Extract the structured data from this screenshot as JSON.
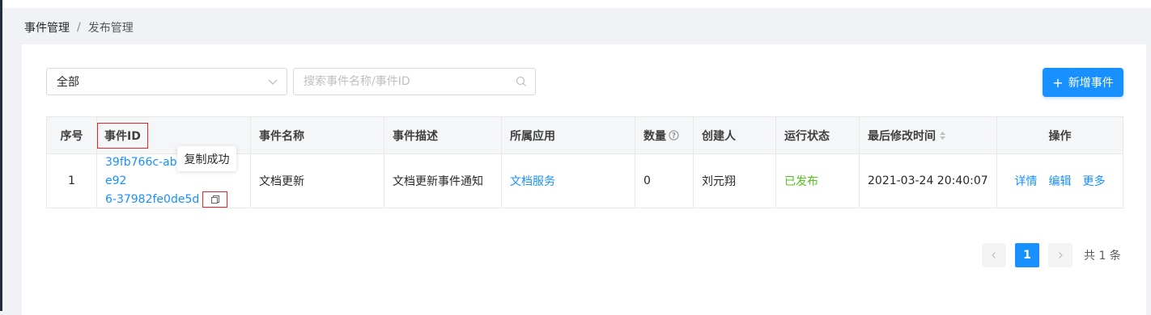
{
  "breadcrumb": {
    "parent": "事件管理",
    "separator": "/",
    "current": "发布管理"
  },
  "filters": {
    "select_value": "全部",
    "search_placeholder": "搜索事件名称/事件ID",
    "add_button": "新增事件"
  },
  "table": {
    "headers": {
      "index": "序号",
      "event_id": "事件ID",
      "event_name": "事件名称",
      "event_desc": "事件描述",
      "app": "所属应用",
      "count": "数量",
      "creator": "创建人",
      "status": "运行状态",
      "modified": "最后修改时间",
      "ops": "操作"
    },
    "rows": [
      {
        "index": "1",
        "event_id_line1": "39fb766c-ab2d-4c09-e92",
        "event_id_line2": "6-37982fe0de5d",
        "event_name": "文档更新",
        "event_desc": "文档更新事件通知",
        "app": "文档服务",
        "count": "0",
        "creator": "刘元翔",
        "status": "已发布",
        "modified": "2021-03-24 20:40:07",
        "op_detail": "详情",
        "op_edit": "编辑",
        "op_more": "更多"
      }
    ]
  },
  "tooltip": "复制成功",
  "pagination": {
    "current_page": "1",
    "total": "共 1 条"
  },
  "colors": {
    "primary": "#1890ff",
    "success": "#52c41a",
    "highlight": "#e0272f"
  }
}
